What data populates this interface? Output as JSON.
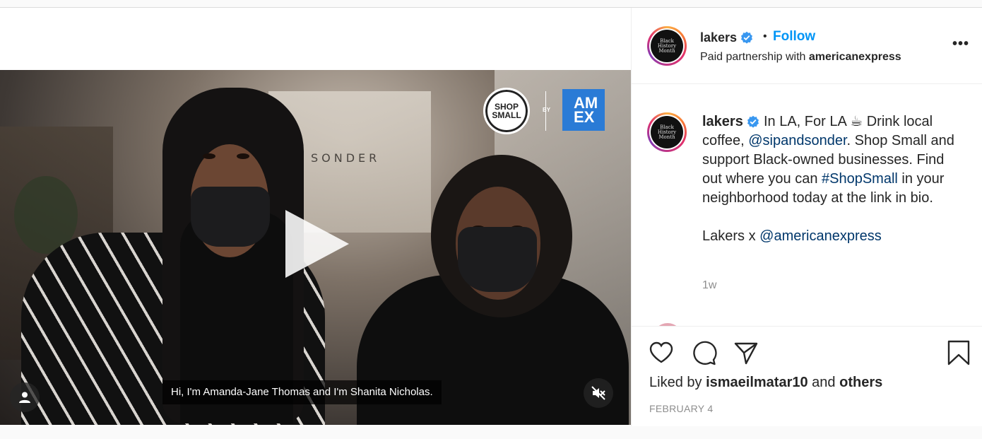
{
  "video": {
    "wall_sign": "SONDER",
    "caption": "Hi, I'm Amanda-Jane Thomas and I'm Shanita Nicholas.",
    "shop_small_line1": "SHOP",
    "shop_small_line2": "SMALL",
    "by_label": "BY",
    "amex_line1": "AM",
    "amex_line2": "EX"
  },
  "header": {
    "username": "lakers",
    "separator": "•",
    "follow_label": "Follow",
    "partnership_prefix": "Paid partnership with",
    "partner": "americanexpress",
    "avatar_text_1": "Black",
    "avatar_text_2": "History",
    "avatar_text_3": "Month",
    "more_label": "•••"
  },
  "comment": {
    "username": "lakers",
    "text_1": "In LA, For LA ☕ Drink local coffee,",
    "mention_1": "@sipandsonder",
    "text_2": ". Shop Small and support Black-owned businesses. Find out where you can",
    "hashtag": "#ShopSmall",
    "text_3": "in your neighborhood today at the link in bio.",
    "text_4": "Lakers x",
    "mention_2": "@americanexpress",
    "age": "1w"
  },
  "actions": {
    "liked_by_prefix": "Liked by",
    "liked_by_user": "ismaeilmatar10",
    "liked_by_mid": "and",
    "liked_by_others": "others",
    "date": "FEBRUARY 4"
  },
  "colors": {
    "follow": "#0095f6",
    "link": "#00376b",
    "verified": "#3897f0",
    "amex": "#2a7bd6"
  }
}
